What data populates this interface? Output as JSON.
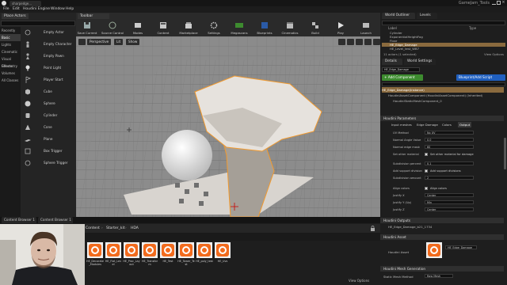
{
  "titlebar": {
    "doc_tab": "sharpedge...",
    "project": "GameJam_Tools"
  },
  "menubar": [
    "File",
    "Edit",
    "Houdini Engine",
    "Window",
    "Help"
  ],
  "modes": {
    "tab": "Place Actors",
    "categories": [
      "Recently Placed",
      "Basic",
      "Lights",
      "Cinematic",
      "Visual Effects",
      "Geometry",
      "Volumes",
      "All Classes"
    ],
    "selected_category": "Basic",
    "items": [
      "Empty Actor",
      "Empty Character",
      "Empty Pawn",
      "Point Light",
      "Player Start",
      "Cube",
      "Sphere",
      "Cylinder",
      "Cone",
      "Plane",
      "Box Trigger",
      "Sphere Trigger"
    ]
  },
  "toolbar": {
    "tab": "Toolbar",
    "buttons": [
      "Save Current",
      "Source Control",
      "Modes",
      "Content",
      "Marketplace",
      "Settings",
      "Megascans",
      "Blueprints",
      "Cinematics",
      "Build",
      "Play",
      "Launch"
    ]
  },
  "viewport": {
    "perspective": "Perspective",
    "lit": "Lit",
    "show": "Show",
    "view_options": "View Options"
  },
  "content_browser": {
    "tabs": [
      "Content Browser 1",
      "Content Browser 1"
    ],
    "path": [
      "Content",
      "Starter_kit",
      "HDA"
    ],
    "assets": [
      "HE_Decorate_Modules",
      "HE_Flat_Level",
      "HE_Proc_Layout",
      "HE_Transform",
      "HE_Test",
      "HE_Tower_Test",
      "HE_poly_test",
      "HE_Uvs"
    ],
    "view_options": "View Options"
  },
  "world_outliner": {
    "tabs": [
      "World Outliner",
      "Levels"
    ],
    "col_label": "Label",
    "col_type": "Type",
    "rows": [
      "Cylinder",
      "ExponentialHeightFog",
      "Floor",
      "HE_Edge_Damage",
      "HE_Level_test_WB7"
    ],
    "selected_row": "HE_Edge_Damage",
    "status": "11 actors (1 selected)",
    "view_options": "View Options"
  },
  "details": {
    "tabs": [
      "Details",
      "World Settings"
    ],
    "actor_name": "HE_Edge_Damage",
    "add_component": "+ Add Component",
    "blueprint": "Blueprint/Add Script",
    "component_root": "HE_Edge_Damage(Instance)",
    "component_1": "HoudiniAssetComponent (HoudiniAssetComponent) (Inherited)",
    "component_2": "HoudiniStaticMeshComponent_0",
    "section_params": "Houdini Parameters",
    "param_tabs": [
      "Input meshes",
      "Edge Damage",
      "Colors",
      "Output"
    ],
    "params": [
      {
        "label": "UV Method",
        "value": "No UV"
      },
      {
        "label": "Normal Angle Value",
        "value": "0.0"
      },
      {
        "label": "Normal edge mask",
        "value": "60"
      },
      {
        "label": "Set other material",
        "value": "Set other material for damage"
      },
      {
        "label": "Subdivision percent",
        "value": "0.1"
      },
      {
        "label": "Add support division",
        "value": "Add support divisions"
      },
      {
        "label": "Subdivision amount",
        "value": "2"
      },
      {
        "label": "Align colors",
        "value": "Align colors"
      },
      {
        "label": "Justify X",
        "value": "Center"
      },
      {
        "label": "Justify Y (Up)",
        "value": "Min"
      },
      {
        "label": "Justify Z",
        "value": "Center"
      }
    ],
    "section_outputs": "Houdini Outputs",
    "output_value": "HE_Edge_Damage_b21_1734",
    "section_asset": "Houdini Asset",
    "asset_label": "Houdini Asset",
    "asset_value": "HE_Edge_Damage",
    "section_mesh": "Houdini Mesh Generation",
    "mesh_label": "Static Mesh Method",
    "mesh_value": "Raw Mesh"
  },
  "colors": {
    "accent_orange": "#f26b1d",
    "select_brown": "#8a6a3e",
    "blue_button": "#1f5fbf",
    "green_button": "#3d8b2f"
  }
}
